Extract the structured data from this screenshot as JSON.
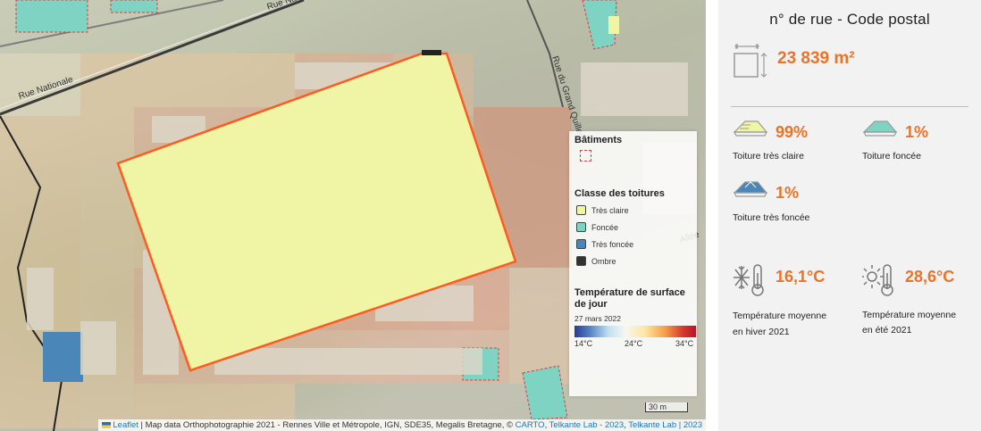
{
  "map": {
    "roads": [
      "Rue Nationale",
      "Rue Nationale",
      "Rue du Grand Quillem",
      "Allée"
    ],
    "legend": {
      "buildings_title": "Bâtiments",
      "roof_class_title": "Classe des toitures",
      "roof_classes": [
        {
          "label": "Très claire",
          "color": "#f0f5a6"
        },
        {
          "label": "Foncée",
          "color": "#7fd3c2"
        },
        {
          "label": "Très foncée",
          "color": "#4b86b8"
        },
        {
          "label": "Ombre",
          "color": "#333333"
        }
      ],
      "temp_title": "Température de surface de jour",
      "temp_date": "27 mars 2022",
      "temp_ticks": [
        "14°C",
        "24°C",
        "34°C"
      ]
    },
    "scale_label": "30 m",
    "attribution": {
      "leaflet": "Leaflet",
      "text": "| Map data Orthophotographie 2021 - Rennes Ville et Métropole, IGN, SDE35, Megalis Bretagne, ©",
      "carto": "CARTO",
      "sep1": ",",
      "telkante1": "Telkante Lab - 2023",
      "sep2": ",",
      "telkante2": "Telkante Lab | 2023"
    }
  },
  "panel": {
    "title": "n° de rue - Code postal",
    "area": "23 839 m²",
    "roof_light": {
      "value": "99%",
      "label": "Toiture très claire"
    },
    "roof_dark": {
      "value": "1%",
      "label": "Toiture foncée"
    },
    "roof_very_dark": {
      "value": "1%",
      "label": "Toiture très foncée"
    },
    "temp_winter": {
      "value": "16,1°C",
      "label_line1": "Température moyenne",
      "label_line2": "en hiver 2021"
    },
    "temp_summer": {
      "value": "28,6°C",
      "label_line1": "Température moyenne",
      "label_line2": "en été 2021"
    }
  }
}
